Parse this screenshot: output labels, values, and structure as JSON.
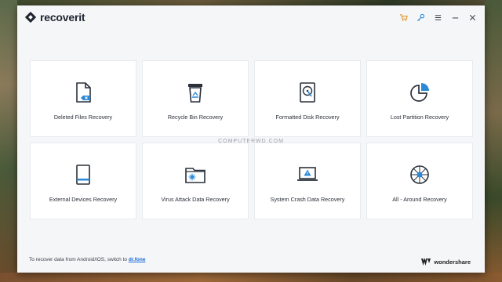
{
  "app": {
    "title_prefix": "recover",
    "title_suffix": "it"
  },
  "toolbar": {
    "icons": [
      "cart-icon",
      "key-icon",
      "menu-icon",
      "minimize-icon",
      "close-icon"
    ]
  },
  "watermark": "COMPUTERWD.COM",
  "cards": [
    {
      "label": "Deleted Files Recovery",
      "icon": "deleted-file-icon"
    },
    {
      "label": "Recycle Bin Recovery",
      "icon": "recycle-bin-icon"
    },
    {
      "label": "Formatted Disk Recovery",
      "icon": "hard-disk-icon"
    },
    {
      "label": "Lost Partition Recovery",
      "icon": "partition-pie-icon"
    },
    {
      "label": "External Devices Recovery",
      "icon": "external-device-icon"
    },
    {
      "label": "Virus Attack Data Recovery",
      "icon": "virus-folder-icon"
    },
    {
      "label": "System Crash Data Recovery",
      "icon": "system-crash-icon"
    },
    {
      "label": "All - Around Recovery",
      "icon": "all-around-icon"
    }
  ],
  "footer": {
    "text": "To recover data from Android/iOS, switch to ",
    "link": "dr.fone"
  },
  "brand": {
    "name": "wondershare"
  },
  "colors": {
    "accent": "#1a6ad8",
    "cart": "#e0962a",
    "key": "#2a8ad8",
    "icon_dark": "#2b303a",
    "icon_blue": "#2a8ad8"
  }
}
